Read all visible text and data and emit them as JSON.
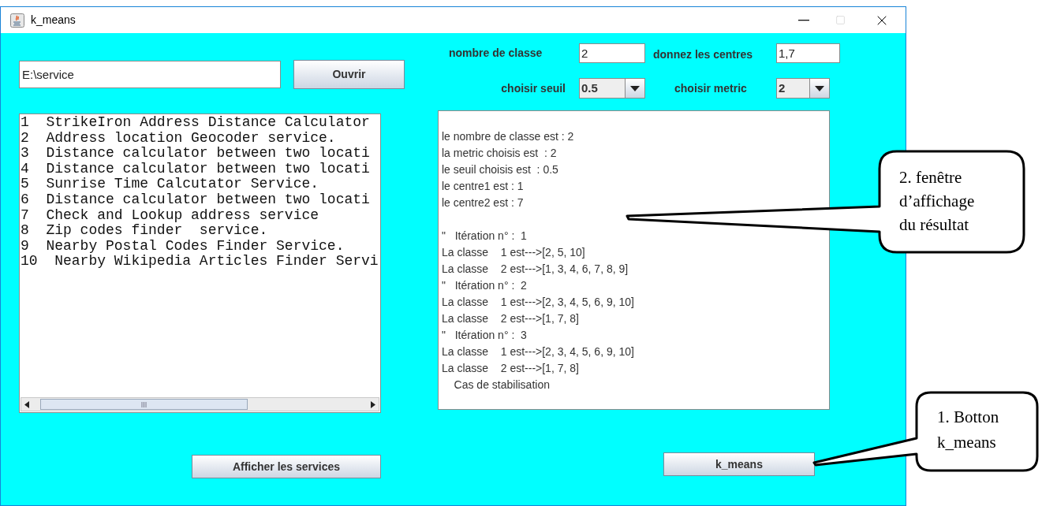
{
  "window": {
    "title": "k_means"
  },
  "path_field": {
    "value": "E:\\service"
  },
  "open_button": "Ouvrir",
  "params": {
    "class_count": {
      "label": "nombre de classe",
      "value": "2"
    },
    "centers": {
      "label": "donnez les centres",
      "value": "1,7"
    },
    "threshold": {
      "label": "choisir seuil",
      "value": "0.5"
    },
    "metric": {
      "label": "choisir metric",
      "value": "2"
    }
  },
  "service_list": [
    "1  StrikeIron Address Distance Calculator",
    "2  Address location Geocoder service.",
    "3  Distance calculator between two locati",
    "4  Distance calculator between two locati",
    "5  Sunrise Time Calcutator Service.",
    "6  Distance calculator between two locati",
    "7  Check and Lookup address service",
    "8  Zip codes finder  service.",
    "9  Nearby Postal Codes Finder Service.",
    "10  Nearby Wikipedia Articles Finder Servi"
  ],
  "result": {
    "summary": [
      "le nombre de classe est : 2",
      "la metric choisis est  : 2",
      "le seuil choisis est  : 0.5",
      "le centre1 est : 1",
      "le centre2 est : 7"
    ],
    "log": [
      "\"   Itération n° :  1",
      "La classe    1 est--->[2, 5, 10]",
      "La classe    2 est--->[1, 3, 4, 6, 7, 8, 9]",
      "\"   Itération n° :  2",
      "La classe    1 est--->[2, 3, 4, 5, 6, 9, 10]",
      "La classe    2 est--->[1, 7, 8]",
      "\"   Itération n° :  3",
      "La classe    1 est--->[2, 3, 4, 5, 6, 9, 10]",
      "La classe    2 est--->[1, 7, 8]",
      "    Cas de stabilisation"
    ]
  },
  "show_services_button": "Afficher les services",
  "kmeans_button": "k_means",
  "callouts": [
    {
      "lines": [
        "2. fenêtre",
        "d’affichage",
        "du résultat"
      ]
    },
    {
      "lines": [
        "1. Botton",
        "k_means"
      ]
    }
  ]
}
